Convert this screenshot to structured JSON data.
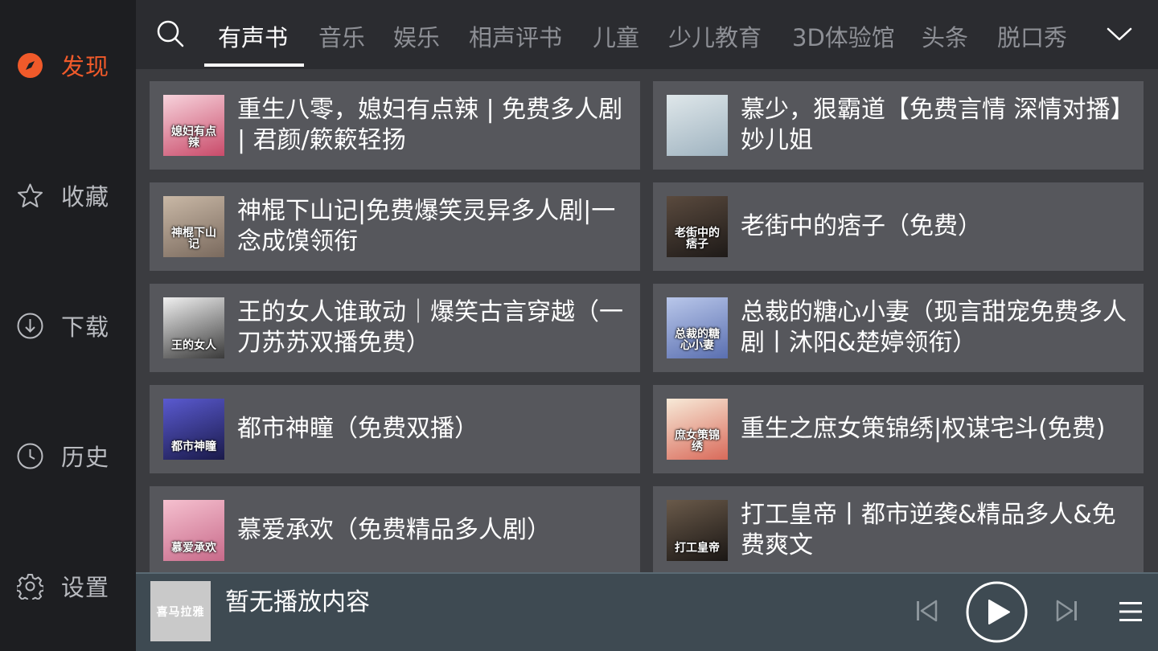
{
  "sidebar": {
    "items": [
      {
        "label": "发现",
        "icon": "compass-icon",
        "active": true
      },
      {
        "label": "收藏",
        "icon": "star-icon",
        "active": false
      },
      {
        "label": "下载",
        "icon": "download-icon",
        "active": false
      },
      {
        "label": "历史",
        "icon": "clock-icon",
        "active": false
      },
      {
        "label": "设置",
        "icon": "gear-icon",
        "active": false
      }
    ]
  },
  "tabs": [
    {
      "label": "有声书",
      "active": true
    },
    {
      "label": "音乐",
      "active": false
    },
    {
      "label": "娱乐",
      "active": false
    },
    {
      "label": "相声评书",
      "active": false
    },
    {
      "label": "儿童",
      "active": false
    },
    {
      "label": "少儿教育",
      "active": false
    },
    {
      "label": "3D体验馆",
      "active": false
    },
    {
      "label": "头条",
      "active": false
    },
    {
      "label": "脱口秀",
      "active": false
    }
  ],
  "books": [
    {
      "title": "重生八零，媳妇有点辣 | 免费多人剧 | 君颜/簌簌轻扬",
      "cover_text": "媳妇有点辣",
      "cover_colors": [
        "#f7d3dc",
        "#c94b6a"
      ]
    },
    {
      "title": "慕少，狠霸道【免费言情 深情对播】妙儿姐",
      "cover_text": "",
      "cover_colors": [
        "#dfe7ea",
        "#9fb3c0"
      ]
    },
    {
      "title": "神棍下山记|免费爆笑灵异多人剧|一念成馍领衔",
      "cover_text": "神棍下山记",
      "cover_colors": [
        "#c9b8a6",
        "#7a6a5e"
      ]
    },
    {
      "title": "老街中的痞子（免费）",
      "cover_text": "老街中的痞子",
      "cover_colors": [
        "#5a4a3e",
        "#1e1a18"
      ]
    },
    {
      "title": "王的女人谁敢动｜爆笑古言穿越（一刀苏苏双播免费）",
      "cover_text": "王的女人",
      "cover_colors": [
        "#f0f0f0",
        "#3a3a3a"
      ]
    },
    {
      "title": "总裁的糖心小妻（现言甜宠免费多人剧丨沐阳&楚婷领衔）",
      "cover_text": "总裁的糖心小妻",
      "cover_colors": [
        "#b9c7ea",
        "#5a6fb0"
      ]
    },
    {
      "title": "都市神瞳（免费双播）",
      "cover_text": "都市神瞳",
      "cover_colors": [
        "#5a5ad0",
        "#1a1a4a"
      ]
    },
    {
      "title": "重生之庶女策锦绣|权谋宅斗(免费)",
      "cover_text": "庶女策锦绣",
      "cover_colors": [
        "#f7ead8",
        "#d96a5a"
      ]
    },
    {
      "title": "慕爱承欢（免费精品多人剧）",
      "cover_text": "慕爱承欢",
      "cover_colors": [
        "#f5c0cf",
        "#c86a8a"
      ]
    },
    {
      "title": "打工皇帝丨都市逆袭&精品多人&免费爽文",
      "cover_text": "打工皇帝",
      "cover_colors": [
        "#6a5a4a",
        "#1a1614"
      ]
    }
  ],
  "player": {
    "cover_text": "喜马拉雅",
    "status": "暂无播放内容",
    "controls": [
      "prev-icon",
      "play-icon",
      "next-icon",
      "menu-icon"
    ]
  },
  "colors": {
    "accent": "#f05a2a",
    "card": "#56575c",
    "sidebar": "#1d1e21"
  }
}
